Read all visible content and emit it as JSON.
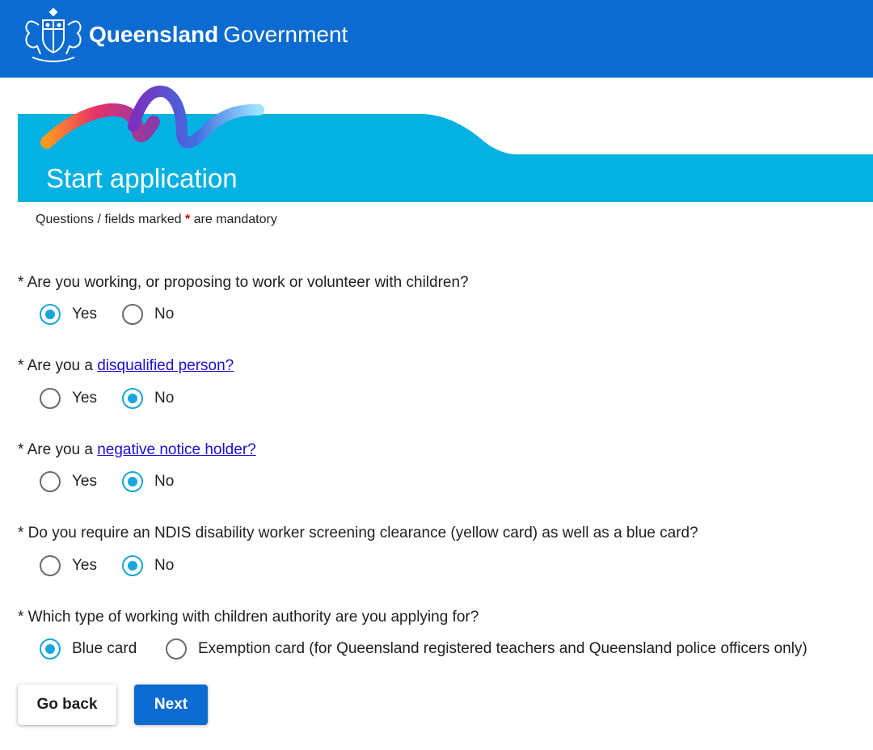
{
  "header": {
    "brand_bold": "Queensland",
    "brand_light": "Government"
  },
  "banner": {
    "title": "Start application"
  },
  "mandatory_note": {
    "prefix": "Questions / fields marked ",
    "marker": "*",
    "suffix": " are mandatory"
  },
  "questions": [
    {
      "prefix": "* Are you working, or proposing to work or volunteer with children?",
      "link": "",
      "options": [
        "Yes",
        "No"
      ],
      "selected": "Yes"
    },
    {
      "prefix": "* Are you a ",
      "link": "disqualified person?",
      "options": [
        "Yes",
        "No"
      ],
      "selected": "No"
    },
    {
      "prefix": "* Are you a ",
      "link": "negative notice holder?",
      "options": [
        "Yes",
        "No"
      ],
      "selected": "No"
    },
    {
      "prefix": "* Do you require an NDIS disability worker screening clearance (yellow card) as well as a blue card?",
      "link": "",
      "options": [
        "Yes",
        "No"
      ],
      "selected": "No"
    },
    {
      "prefix": "* Which type of working with children authority are you applying for?",
      "link": "",
      "options": [
        "Blue card",
        "Exemption card (for Queensland registered teachers and Queensland police officers only)"
      ],
      "selected": "Blue card"
    }
  ],
  "buttons": {
    "back": "Go back",
    "next": "Next"
  },
  "colors": {
    "header_blue": "#0b6bd0",
    "banner_cyan": "#04b1e3",
    "radio_selected": "#19a6da",
    "link": "#1a0dd6",
    "required": "#d0021b"
  }
}
